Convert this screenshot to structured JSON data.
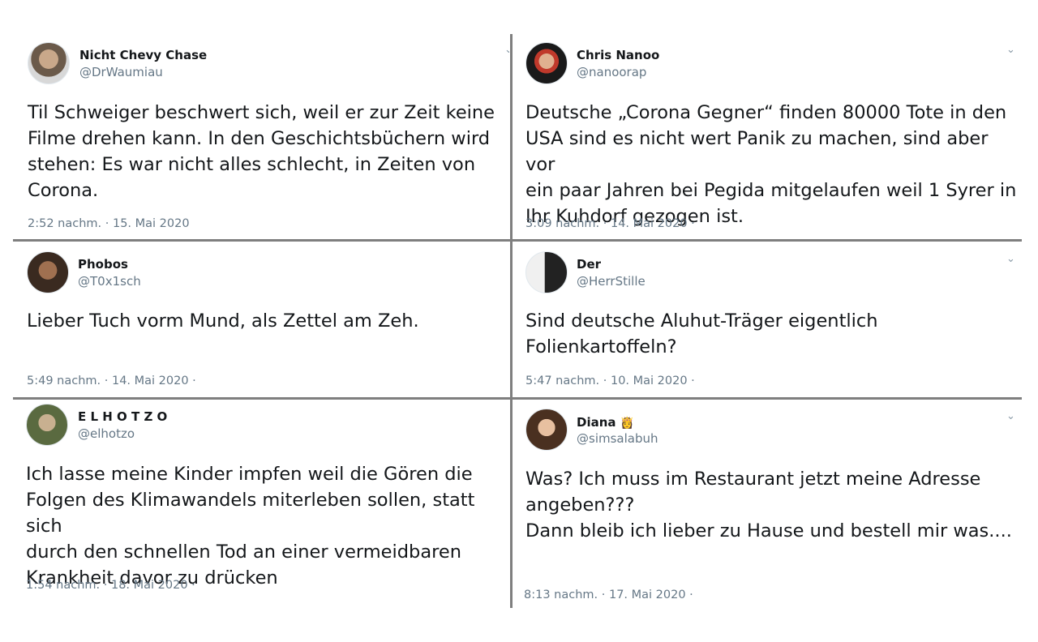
{
  "colors": {
    "divider": "#7f7f7f",
    "handle": "#657786",
    "text": "#14171a"
  },
  "tweets": [
    {
      "name": "Nicht Chevy Chase",
      "handle": "@DrWaumiau",
      "text": "Til Schweiger beschwert sich, weil er zur Zeit keine\nFilme drehen kann. In den Geschichtsbüchern wird\nstehen: Es war nicht alles schlecht, in Zeiten von\nCorona.",
      "meta": "2:52 nachm. · 15. Mai 2020"
    },
    {
      "name": "Chris Nanoo",
      "handle": "@nanoorap",
      "text": "Deutsche „Corona Gegner“ finden 80000 Tote in den\nUSA sind es nicht wert Panik zu machen, sind aber vor\nein paar Jahren bei Pegida mitgelaufen weil 1 Syrer in\nIhr Kuhdorf gezogen ist.",
      "meta": "3:09 nachm. · 14. Mai 2020 ·"
    },
    {
      "name": "Phobos",
      "handle": "@T0x1sch",
      "text": "Lieber Tuch vorm Mund, als Zettel am Zeh.",
      "meta": "5:49 nachm. · 14. Mai 2020 ·"
    },
    {
      "name": "Der",
      "handle": "@HerrStille",
      "text": "Sind deutsche Aluhut-Träger eigentlich\nFolienkartoffeln?",
      "meta": "5:47 nachm. · 10. Mai 2020 ·"
    },
    {
      "name": "E L H O T Z O",
      "handle": "@elhotzo",
      "text": "Ich lasse meine Kinder impfen weil die Gören die\nFolgen des Klimawandels miterleben sollen, statt sich\ndurch den schnellen Tod an einer vermeidbaren\nKrankheit davor zu drücken",
      "meta": "1:54 nachm. · 18. Mai 2020 ·"
    },
    {
      "name": "Diana",
      "emoji": "👸",
      "handle": "@simsalabuh",
      "text": "Was? Ich muss im Restaurant jetzt meine Adresse\nangeben???\nDann bleib ich lieber zu Hause und bestell mir was....",
      "meta": "8:13 nachm. · 17. Mai 2020 ·"
    }
  ],
  "icons": {
    "more": "chevron-down-icon"
  }
}
